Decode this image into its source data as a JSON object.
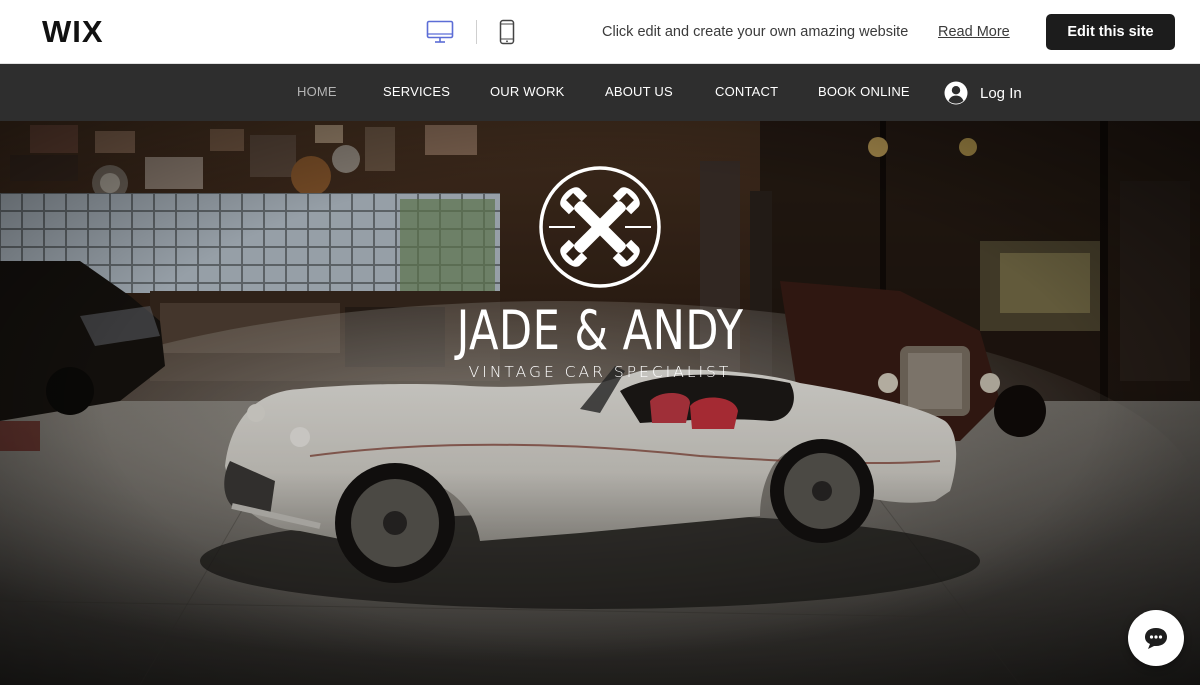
{
  "wix_bar": {
    "logo": "WIX",
    "desktop_icon": "desktop-monitor-icon",
    "mobile_icon": "mobile-phone-icon",
    "promo_text": "Click edit and create your own amazing website",
    "read_more": "Read More",
    "edit_button": "Edit this site"
  },
  "nav": {
    "items": [
      {
        "label": "HOME",
        "active": true
      },
      {
        "label": "SERVICES",
        "active": false
      },
      {
        "label": "OUR WORK",
        "active": false
      },
      {
        "label": "ABOUT US",
        "active": false
      },
      {
        "label": "CONTACT",
        "active": false
      },
      {
        "label": "BOOK ONLINE",
        "active": false
      }
    ],
    "login_label": "Log In",
    "login_icon": "user-avatar-icon"
  },
  "hero": {
    "emblem_icon": "crossed-wrenches-icon",
    "title": "JADE & ANDY",
    "subtitle": "VINTAGE CAR SPECIALIST",
    "background": "vintage-car-garage-photo"
  },
  "chat": {
    "icon": "chat-bubble-icon"
  },
  "colors": {
    "nav_bg": "#2e2e2e",
    "edit_button_bg": "#1c1c1c",
    "active_nav": "#b4b4b4"
  }
}
